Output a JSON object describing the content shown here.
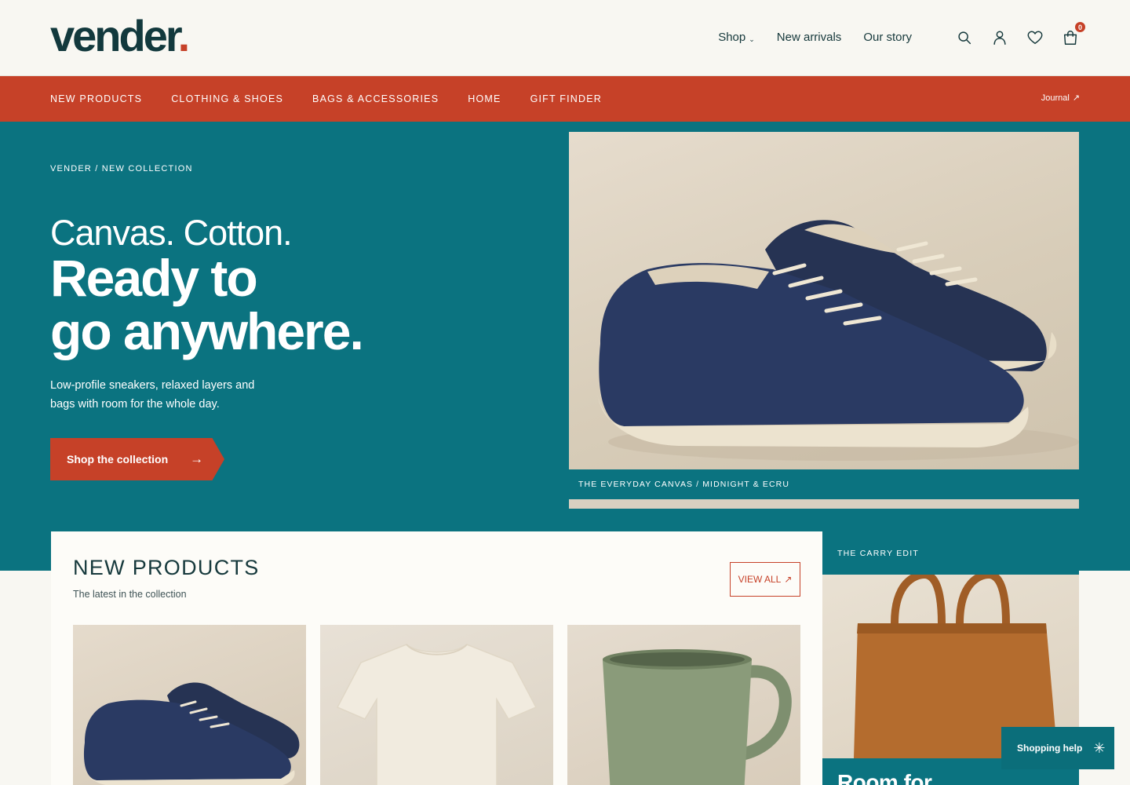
{
  "brand": {
    "name": "vender",
    "dot": ".",
    "accent_color": "#c64128",
    "teal_color": "#0b7380",
    "ink_color": "#12393d"
  },
  "mainnav": {
    "items": [
      {
        "label": "Shop",
        "chevron": "⌄"
      },
      {
        "label": "New arrivals"
      },
      {
        "label": "Our story"
      }
    ]
  },
  "header_icons": {
    "search": "search-icon",
    "account": "user-icon",
    "wishlist": "heart-icon",
    "cart": "shopping-bag-icon",
    "cart_count": "0"
  },
  "catbar": {
    "links": [
      "NEW PRODUCTS",
      "CLOTHING & SHOES",
      "BAGS & ACCESSORIES",
      "HOME",
      "GIFT FINDER"
    ],
    "journal": "Journal",
    "journal_arrow": "↗"
  },
  "hero": {
    "breadcrumb": "VENDER / NEW COLLECTION",
    "line1": "Canvas. Cotton.",
    "line2": "Ready to",
    "line3": "go anywhere.",
    "subtitle": "Low-profile sneakers, relaxed layers and bags with room for the whole day.",
    "cta_label": "Shop the collection",
    "cta_arrow": "→",
    "photo_caption": "THE EVERYDAY CANVAS / MIDNIGHT & ECRU"
  },
  "new_products": {
    "title": "NEW PRODUCTS",
    "subtitle": "The latest in the collection",
    "view_all": "VIEW ALL",
    "view_all_arrow": "↗",
    "cards": [
      {
        "image": "canvas-sneakers"
      },
      {
        "image": "cotton-tshirt"
      },
      {
        "image": "ceramic-mug"
      }
    ]
  },
  "carry_edit": {
    "label": "THE CARRY EDIT",
    "heading": "Room for",
    "image": "canvas-tote-bag"
  },
  "help": {
    "label": "Shopping help",
    "icon": "✳"
  }
}
